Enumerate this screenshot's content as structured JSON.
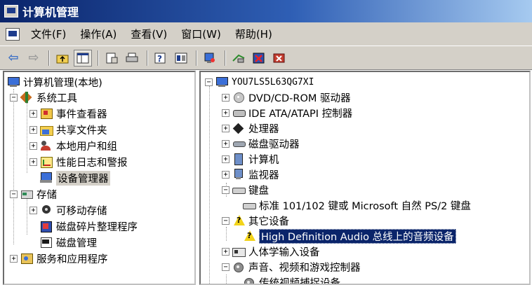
{
  "window": {
    "title": "计算机管理"
  },
  "menubar": {
    "items": [
      {
        "label": "文件(F)"
      },
      {
        "label": "操作(A)"
      },
      {
        "label": "查看(V)"
      },
      {
        "label": "窗口(W)"
      },
      {
        "label": "帮助(H)"
      }
    ]
  },
  "toolbar": {
    "buttons": [
      {
        "icon": "back-arrow-icon"
      },
      {
        "icon": "forward-arrow-icon"
      },
      {
        "icon": "up-folder-icon"
      },
      {
        "icon": "show-hide-tree-icon"
      },
      {
        "icon": "properties-icon"
      },
      {
        "icon": "print-icon"
      },
      {
        "icon": "help-icon"
      },
      {
        "icon": "console-icon"
      },
      {
        "icon": "scan-hardware-icon"
      },
      {
        "icon": "update-driver-icon"
      },
      {
        "icon": "disable-device-icon"
      },
      {
        "icon": "uninstall-device-icon"
      }
    ]
  },
  "left_tree": {
    "root": "计算机管理(本地)",
    "system_tools": "系统工具",
    "event_viewer": "事件查看器",
    "shared_folders": "共享文件夹",
    "local_users": "本地用户和组",
    "perf_logs": "性能日志和警报",
    "device_manager": "设备管理器",
    "storage": "存储",
    "removable_storage": "可移动存储",
    "defrag": "磁盘碎片整理程序",
    "disk_management": "磁盘管理",
    "services_apps": "服务和应用程序"
  },
  "right_tree": {
    "computer_name": "YOU7LS5L63QG7XI",
    "dvd": "DVD/CD-ROM 驱动器",
    "ide": "IDE ATA/ATAPI 控制器",
    "processor": "处理器",
    "disk_drives": "磁盘驱动器",
    "computer": "计算机",
    "monitors": "监视器",
    "keyboards": "键盘",
    "keyboard_device": "标准 101/102 键或 Microsoft 自然 PS/2 键盘",
    "other_devices": "其它设备",
    "hd_audio": "High Definition Audio 总线上的音频设备",
    "hid": "人体学输入设备",
    "sound_video": "声音、视频和游戏控制器",
    "video_capture": "传统视频捕捉设备"
  },
  "colors": {
    "titlebar_start": "#0a246a",
    "titlebar_end": "#a6caf0",
    "chrome": "#d4d0c8",
    "selection": "#0a246a"
  }
}
